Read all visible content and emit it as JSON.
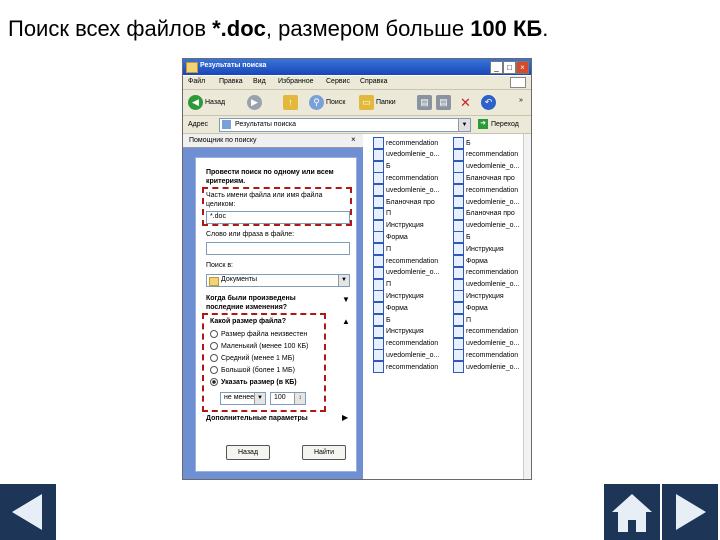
{
  "slide": {
    "title_prefix": "Поиск всех файлов ",
    "title_ext": "*.doc",
    "title_mid": ", размером больше ",
    "title_size": "100 КБ",
    "title_end": "."
  },
  "window": {
    "title": "Результаты поиска",
    "controls": [
      "_",
      "□",
      "×"
    ],
    "menu": [
      "Файл",
      "Правка",
      "Вид",
      "Избранное",
      "Сервис",
      "Справка"
    ],
    "toolbar": {
      "back": "Назад",
      "search": "Поиск",
      "folders": "Папки",
      "more": "»"
    },
    "address": {
      "label": "Адрес",
      "value": "Результаты поиска",
      "go": "Переход"
    }
  },
  "search_pane": {
    "header": "Помощник по поиску",
    "close": "×",
    "criteria_heading": "Провести поиск по одному или всем критериям.",
    "name_label": "Часть имени файла или имя файла целиком:",
    "name_value": "*.doc",
    "phrase_label": "Слово или фраза в файле:",
    "phrase_value": "",
    "look_in_label": "Поиск в:",
    "look_in_value": "Документы",
    "when_modified": "Когда были произведены последние изменения?",
    "size_heading": "Какой размер файла?",
    "size_options": [
      {
        "label": "Размер файла неизвестен",
        "selected": false
      },
      {
        "label": "Маленький (менее 100 КБ)",
        "selected": false
      },
      {
        "label": "Средний (менее 1 МБ)",
        "selected": false
      },
      {
        "label": "Большой (более 1 МБ)",
        "selected": false
      },
      {
        "label": "Указать размер (в КБ)",
        "selected": true
      }
    ],
    "size_compare": "не менее",
    "size_value": "100",
    "advanced": "Дополнительные параметры",
    "back_button": "Назад",
    "find_button": "Найти"
  },
  "files_col1": [
    "recommendation",
    "uvedomlenie_o...",
    "Б",
    "recommendation",
    "uvedomlenie_o...",
    "Бланочная про",
    "П",
    "Инструкция",
    "Форма",
    "П",
    "recommendation",
    "uvedomlenie_o...",
    "П",
    "Инструкция",
    "Форма",
    "Б",
    "Инструкция",
    "recommendation",
    "uvedomlenie_o...",
    "recommendation"
  ],
  "files_col2": [
    "Б",
    "recommendation",
    "uvedomlenie_o...",
    "Бланочная про",
    "recommendation",
    "uvedomlenie_o...",
    "Бланочная про",
    "uvedomlenie_o...",
    "Б",
    "Инструкция",
    "Форма",
    "recommendation",
    "uvedomlenie_o...",
    "Инструкция",
    "Форма",
    "П",
    "recommendation",
    "uvedomlenie_o...",
    "recommendation",
    "uvedomlenie_o..."
  ],
  "nav": {
    "prev": "previous",
    "home": "home",
    "next": "next"
  },
  "colors": {
    "nav": "#1d3557",
    "dash": "#b01818",
    "pane": "#6f8fd3"
  }
}
